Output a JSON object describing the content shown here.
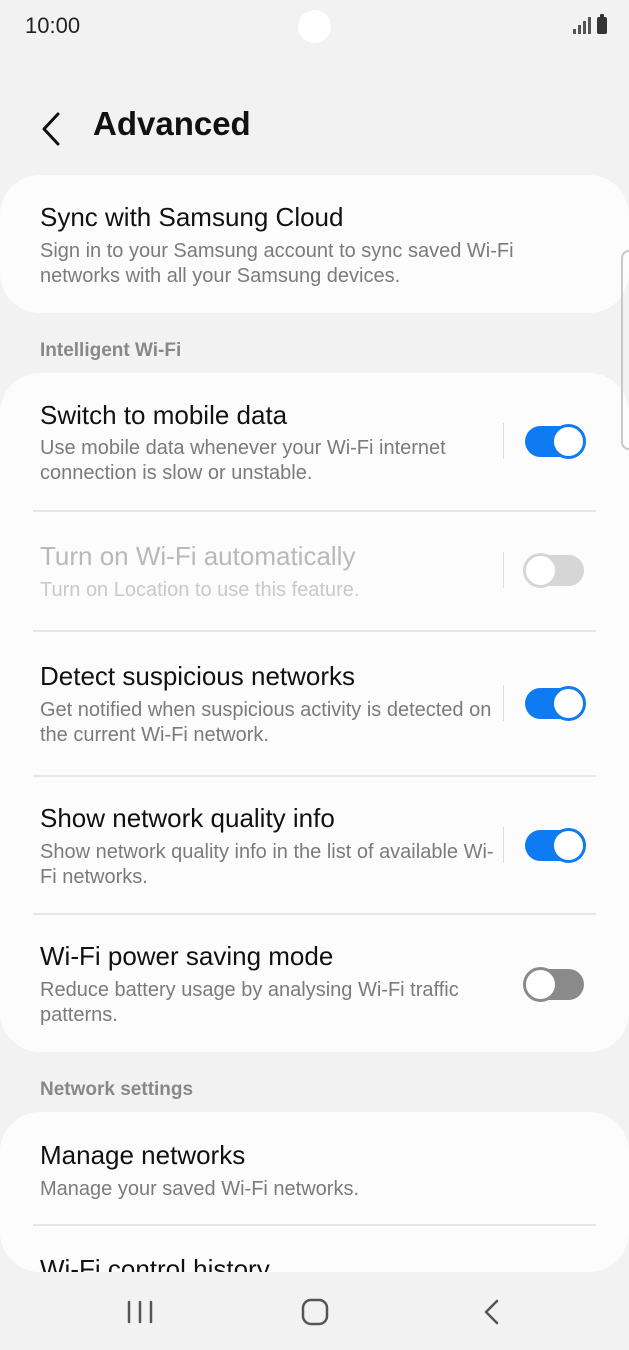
{
  "status_bar": {
    "time": "10:00"
  },
  "header": {
    "title": "Advanced"
  },
  "sync_card": {
    "title": "Sync with Samsung Cloud",
    "description": "Sign in to your Samsung account to sync saved Wi-Fi networks with all your Samsung devices."
  },
  "intelligent_wifi": {
    "section_label": "Intelligent Wi-Fi",
    "items": [
      {
        "title": "Switch to mobile data",
        "description": "Use mobile data whenever your Wi-Fi internet connection is slow or unstable.",
        "toggle": "on"
      },
      {
        "title": "Turn on Wi-Fi automatically",
        "description": "Turn on Location to use this feature.",
        "toggle": "disabled"
      },
      {
        "title": "Detect suspicious networks",
        "description": "Get notified when suspicious activity is detected on the current Wi-Fi network.",
        "toggle": "on"
      },
      {
        "title": "Show network quality info",
        "description": "Show network quality info in the list of available Wi-Fi networks.",
        "toggle": "on"
      },
      {
        "title": "Wi-Fi power saving mode",
        "description": "Reduce battery usage by analysing Wi-Fi traffic patterns.",
        "toggle": "off"
      }
    ]
  },
  "network_settings": {
    "section_label": "Network settings",
    "items": [
      {
        "title": "Manage networks",
        "description": "Manage your saved Wi-Fi networks."
      },
      {
        "title": "Wi-Fi control history",
        "description": ""
      }
    ]
  },
  "nav_bar": {
    "icons": [
      "recent-apps-icon",
      "home-icon",
      "back-icon"
    ]
  },
  "colors": {
    "accent": "#0f7bf2",
    "background": "#f2f2f2",
    "card": "#fcfcfc"
  }
}
